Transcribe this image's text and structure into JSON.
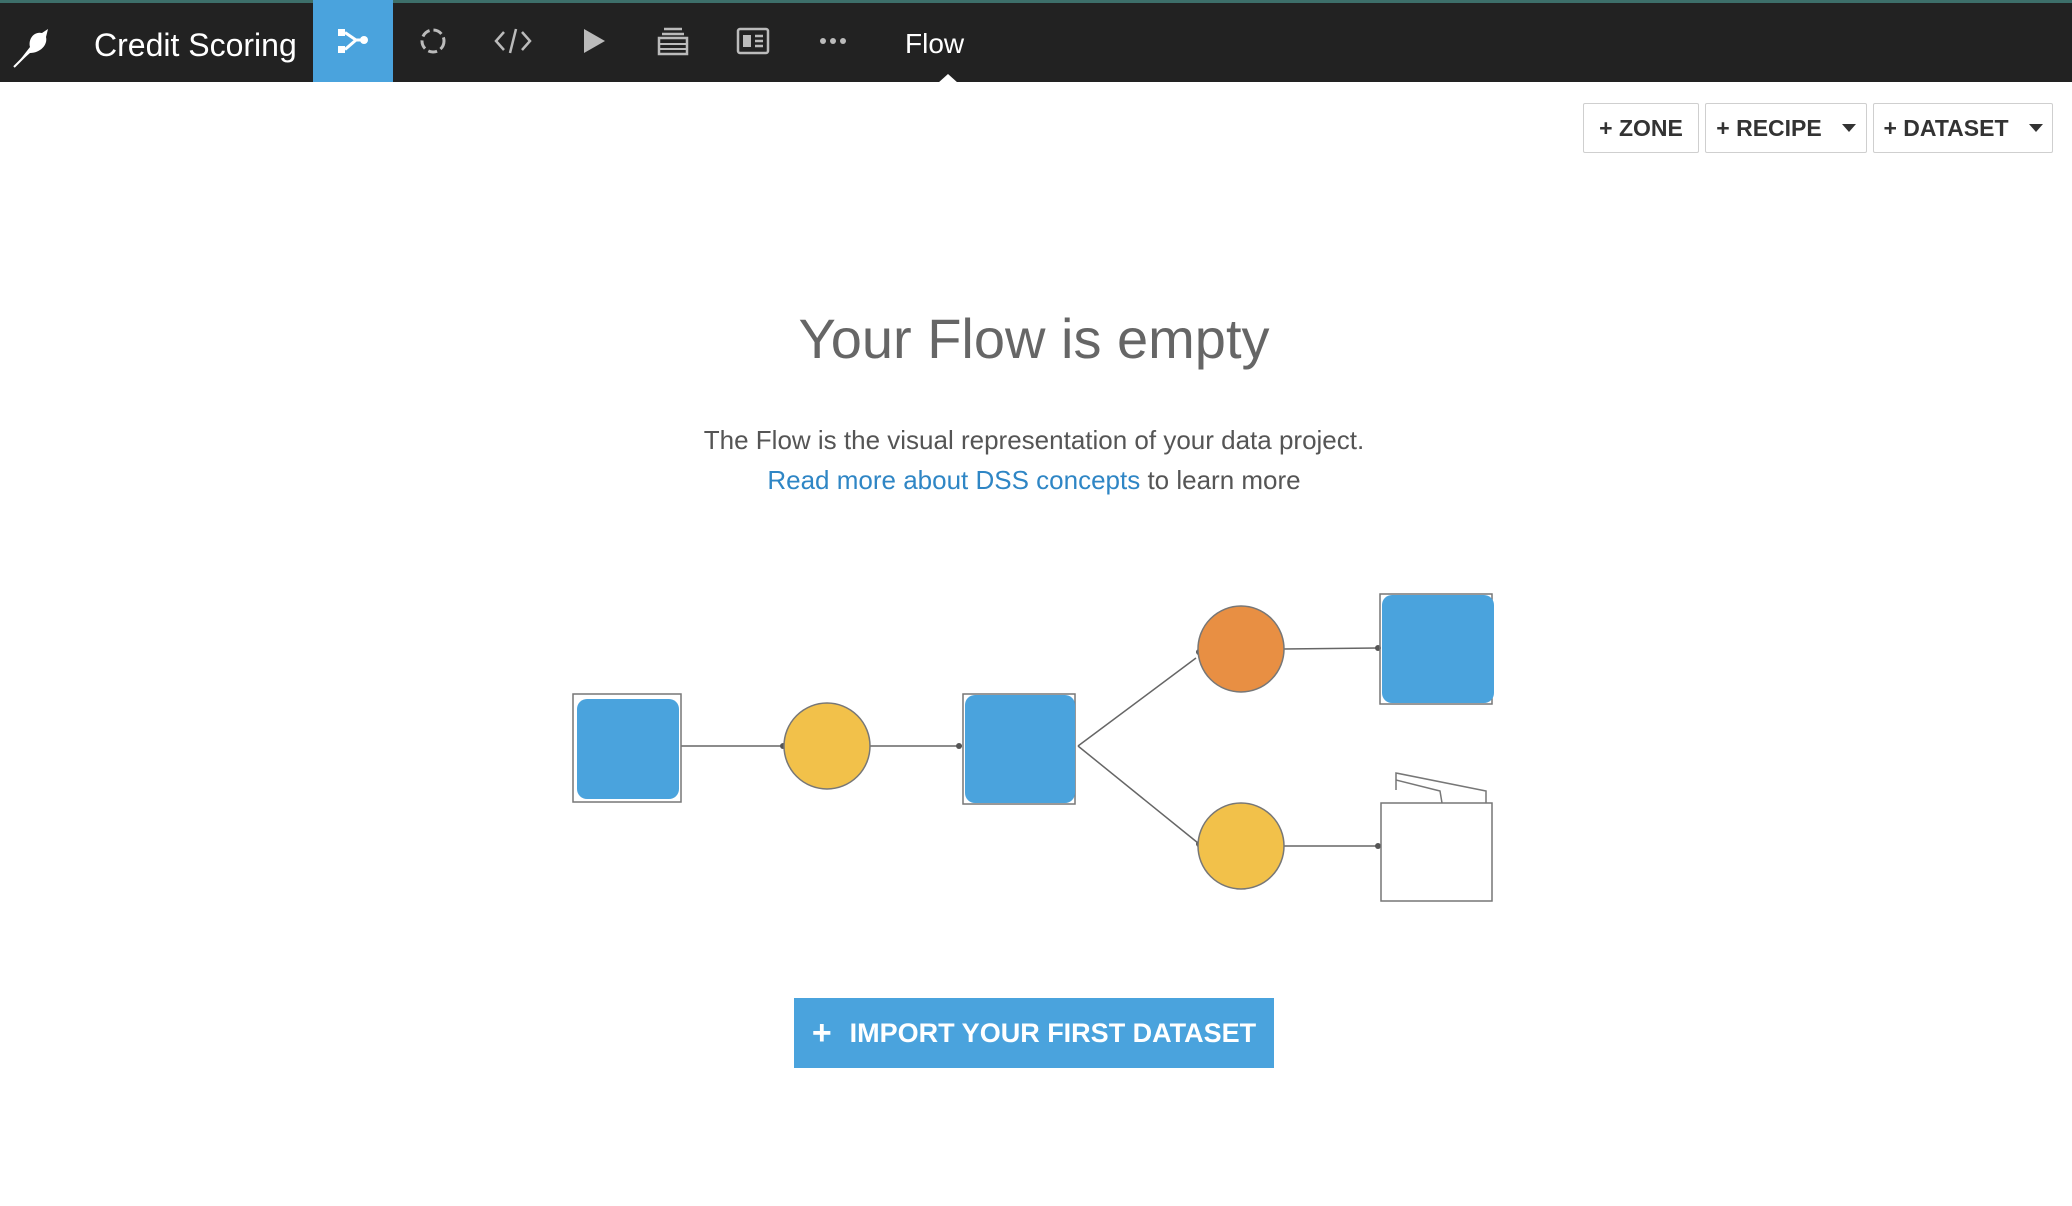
{
  "topbar": {
    "project_name": "Credit Scoring",
    "current_section": "Flow",
    "nav_items": [
      {
        "icon": "flow-icon",
        "active": true
      },
      {
        "icon": "lab-icon",
        "active": false
      },
      {
        "icon": "code-icon",
        "active": false
      },
      {
        "icon": "run-icon",
        "active": false
      },
      {
        "icon": "wiki-icon",
        "active": false
      },
      {
        "icon": "dashboard-icon",
        "active": false
      },
      {
        "icon": "more-icon",
        "active": false
      }
    ]
  },
  "actions": {
    "zone_label": "+ ZONE",
    "recipe_label": "+ RECIPE",
    "dataset_label": "+ DATASET"
  },
  "empty_state": {
    "title": "Your Flow is empty",
    "description": "The Flow is the visual representation of your data project.",
    "link_text": "Read more about DSS concepts",
    "link_suffix": " to learn more",
    "import_button_icon": "+",
    "import_button_label": "IMPORT YOUR FIRST DATASET"
  },
  "colors": {
    "topbar_bg": "#222222",
    "accent_blue": "#4aa3dd",
    "link_blue": "#2f86c5",
    "recipe_yellow": "#f2c14a",
    "recipe_orange": "#e88f43"
  }
}
